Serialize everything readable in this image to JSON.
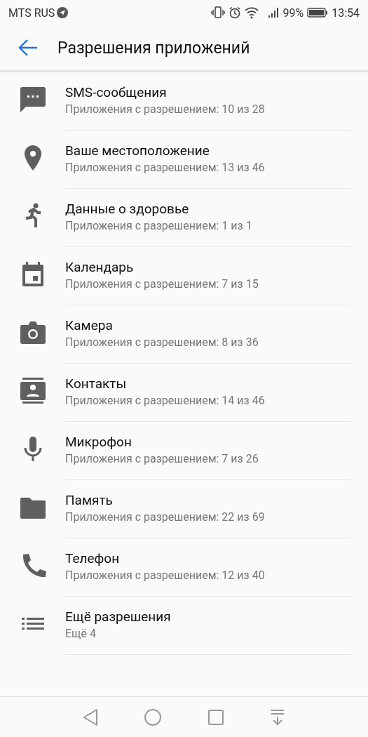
{
  "status_bar": {
    "carrier": "MTS RUS",
    "battery": "99%",
    "time": "13:54"
  },
  "toolbar": {
    "title": "Разрешения приложений"
  },
  "permissions": [
    {
      "kind": "sms",
      "title": "SMS-сообщения",
      "subtitle": "Приложения с разрешением: 10 из 28"
    },
    {
      "kind": "location",
      "title": "Ваше местоположение",
      "subtitle": "Приложения с разрешением: 13 из 46"
    },
    {
      "kind": "health",
      "title": "Данные о здоровье",
      "subtitle": "Приложения с разрешением: 1 из 1"
    },
    {
      "kind": "calendar",
      "title": "Календарь",
      "subtitle": "Приложения с разрешением: 7 из 15"
    },
    {
      "kind": "camera",
      "title": "Камера",
      "subtitle": "Приложения с разрешением: 8 из 36"
    },
    {
      "kind": "contacts",
      "title": "Контакты",
      "subtitle": "Приложения с разрешением: 14 из 46"
    },
    {
      "kind": "microphone",
      "title": "Микрофон",
      "subtitle": "Приложения с разрешением: 7 из 26"
    },
    {
      "kind": "storage",
      "title": "Память",
      "subtitle": "Приложения с разрешением: 22 из 69"
    },
    {
      "kind": "phone",
      "title": "Телефон",
      "subtitle": "Приложения с разрешением: 12 из 40"
    },
    {
      "kind": "more",
      "title": "Ещё разрешения",
      "subtitle": "Ещё 4"
    }
  ]
}
